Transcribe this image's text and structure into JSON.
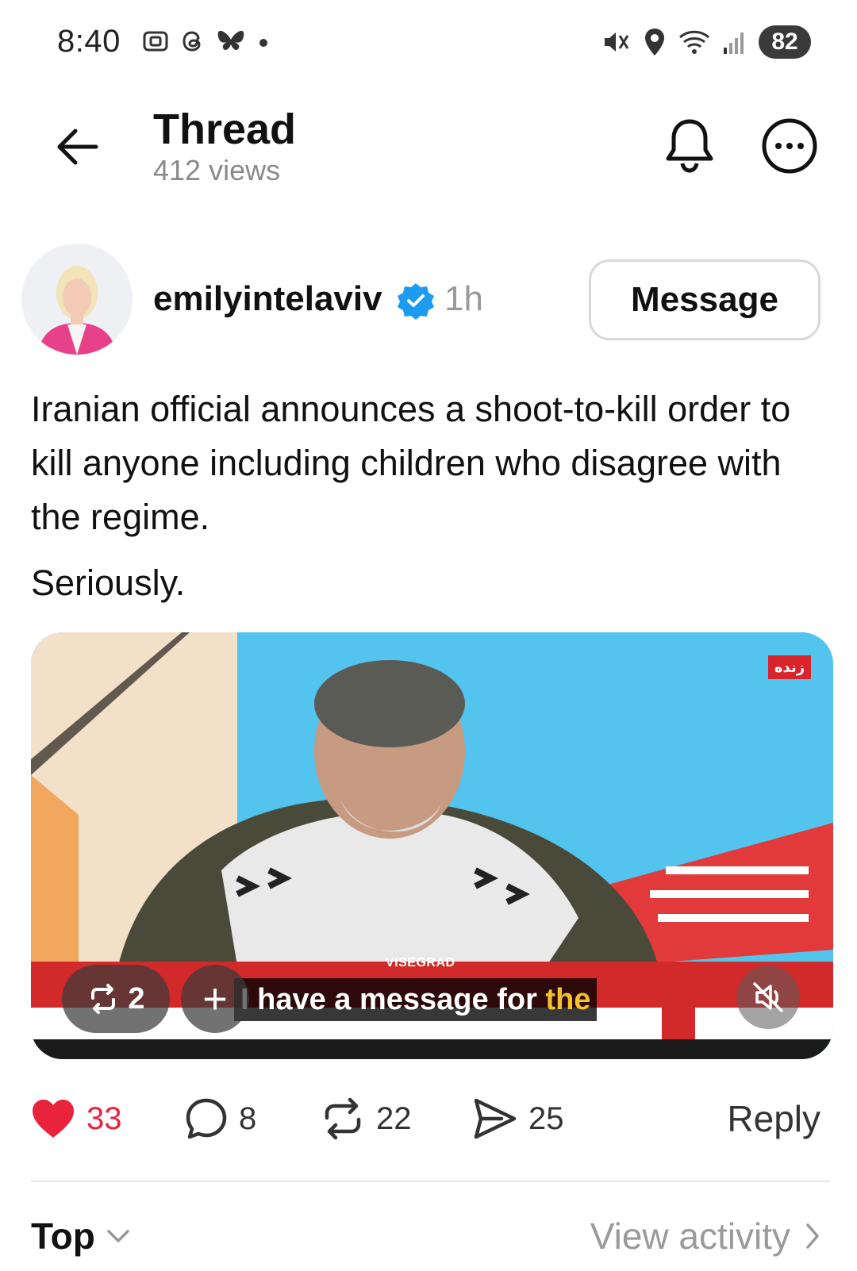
{
  "status_bar": {
    "time": "8:40",
    "left_icons": [
      "screenshot-icon",
      "threads-icon",
      "bluesky-icon",
      "dot-icon"
    ],
    "right_icons": [
      "mute-icon",
      "location-icon",
      "wifi-icon",
      "signal-icon"
    ],
    "battery": "82"
  },
  "header": {
    "title": "Thread",
    "views": "412 views"
  },
  "post": {
    "username": "emilyintelaviv",
    "verified": true,
    "time_ago": "1h",
    "message_label": "Message",
    "text": "Iranian official announces a shoot-to-kill order to kill anyone including children who disagree with the regime.",
    "text2": "Seriously.",
    "video": {
      "caption_main": "I have a message for ",
      "caption_highlight": "the",
      "watermark": "VISEGRAD",
      "live_badge": "زنده",
      "repost_count": "2",
      "add_symbol": "+"
    }
  },
  "actions": {
    "likes": "33",
    "comments": "8",
    "reposts": "22",
    "shares": "25",
    "reply_label": "Reply"
  },
  "footer": {
    "sort_label": "Top",
    "view_activity_label": "View activity"
  },
  "colors": {
    "like": "#e8233b",
    "verified": "#1d9bf0",
    "caption_highlight": "#f2c32a"
  }
}
